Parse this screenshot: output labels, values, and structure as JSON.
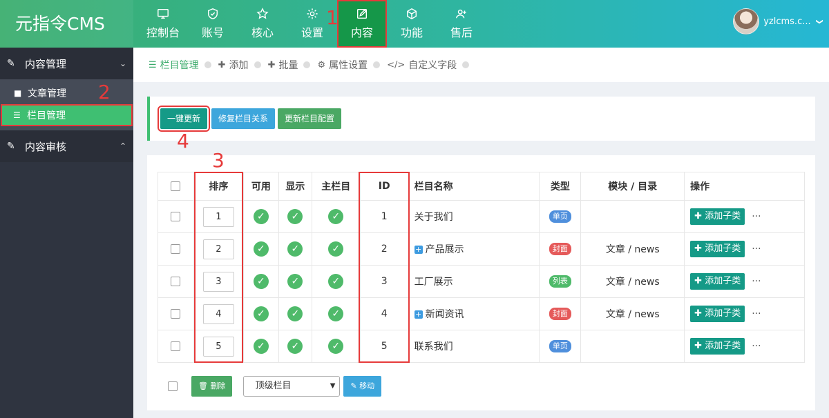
{
  "header": {
    "logo": "元指令CMS",
    "nav": [
      {
        "label": "控制台",
        "icon": "monitor-icon"
      },
      {
        "label": "账号",
        "icon": "shield-icon"
      },
      {
        "label": "核心",
        "icon": "star-icon"
      },
      {
        "label": "设置",
        "icon": "gear-icon"
      },
      {
        "label": "内容",
        "icon": "edit-icon"
      },
      {
        "label": "功能",
        "icon": "cube-icon"
      },
      {
        "label": "售后",
        "icon": "user-plus-icon"
      }
    ],
    "username": "yzlcms.c...",
    "caret": "❯"
  },
  "sidebar": {
    "groups": [
      {
        "label": "内容管理",
        "arrow": "⌄"
      },
      {
        "label": "内容审核",
        "arrow": "⌃"
      }
    ],
    "items": [
      {
        "label": "文章管理"
      },
      {
        "label": "栏目管理"
      }
    ]
  },
  "breadcrumbs": [
    {
      "label": "栏目管理",
      "icon": "☰"
    },
    {
      "label": "添加",
      "icon": "✚"
    },
    {
      "label": "批量",
      "icon": "✚"
    },
    {
      "label": "属性设置",
      "icon": "⚙"
    },
    {
      "label": "自定义字段",
      "icon": "</>"
    }
  ],
  "toolbar": {
    "update_all": "一键更新",
    "repair": "修复栏目关系",
    "update_config": "更新栏目配置"
  },
  "table": {
    "headers": {
      "sort": "排序",
      "enabled": "可用",
      "visible": "显示",
      "main": "主栏目",
      "id": "ID",
      "name": "栏目名称",
      "type": "类型",
      "module": "模块 / 目录",
      "ops": "操作"
    },
    "rows": [
      {
        "sort": "1",
        "id": "1",
        "name": "关于我们",
        "type": "单页",
        "module": "",
        "expand": false
      },
      {
        "sort": "2",
        "id": "2",
        "name": "产品展示",
        "type": "封面",
        "module": "文章 / news",
        "expand": true
      },
      {
        "sort": "3",
        "id": "3",
        "name": "工厂展示",
        "type": "列表",
        "module": "文章 / news",
        "expand": false
      },
      {
        "sort": "4",
        "id": "4",
        "name": "新闻资讯",
        "type": "封面",
        "module": "文章 / news",
        "expand": true
      },
      {
        "sort": "5",
        "id": "5",
        "name": "联系我们",
        "type": "单页",
        "module": "",
        "expand": false
      }
    ],
    "add_child": "添加子类",
    "more": "···",
    "check": "✓",
    "plus": "+"
  },
  "bottom": {
    "delete": "删除",
    "select_value": "顶级栏目",
    "move": "移动"
  },
  "annotations": [
    "1",
    "2",
    "3",
    "4"
  ],
  "colors": {
    "accent": "#3fbf72",
    "teal": "#159a87",
    "red_outline": "#e63a3a"
  }
}
